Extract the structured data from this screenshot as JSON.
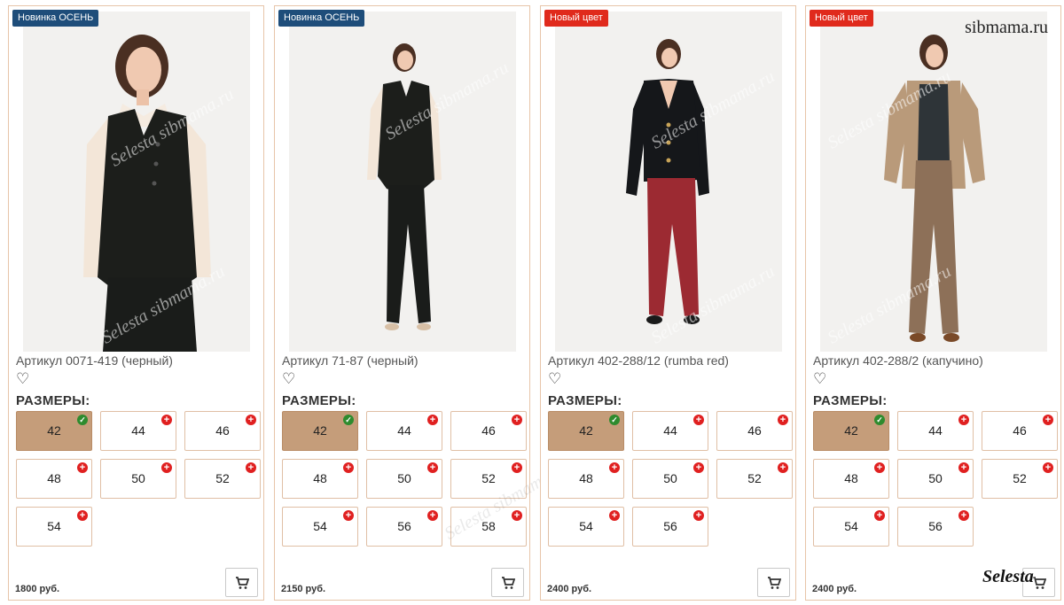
{
  "overlay": {
    "site": "sibmama.ru",
    "brand": "Selesta",
    "watermark": "Selesta sibmama.ru"
  },
  "sizes_title": "РАЗМЕРЫ:",
  "colors": {
    "new_badge": "#1e4d7a",
    "color_badge": "#e02a1c",
    "selected_size": "#c59d7a",
    "add_mark": "#e02020",
    "check_mark": "#2e8b2e"
  },
  "icons": {
    "favorite": "heart-icon",
    "cart": "shopping-cart-icon",
    "available": "check-icon",
    "add": "plus-icon"
  },
  "products": [
    {
      "badge": "Новинка ОСЕНЬ",
      "badge_type": "new",
      "article": "Артикул 0071-419 (черный)",
      "price": "1800 руб.",
      "sizes": [
        "42",
        "44",
        "46",
        "48",
        "50",
        "52",
        "54"
      ],
      "selected_size": "42"
    },
    {
      "badge": "Новинка ОСЕНЬ",
      "badge_type": "new",
      "article": "Артикул 71-87 (черный)",
      "price": "2150 руб.",
      "sizes": [
        "42",
        "44",
        "46",
        "48",
        "50",
        "52",
        "54",
        "56",
        "58"
      ],
      "selected_size": "42"
    },
    {
      "badge": "Новый цвет",
      "badge_type": "color",
      "article": "Артикул 402-288/12 (rumba red)",
      "price": "2400 руб.",
      "sizes": [
        "42",
        "44",
        "46",
        "48",
        "50",
        "52",
        "54",
        "56"
      ],
      "selected_size": "42"
    },
    {
      "badge": "Новый цвет",
      "badge_type": "color",
      "article": "Артикул 402-288/2 (капучино)",
      "price": "2400 руб.",
      "sizes": [
        "42",
        "44",
        "46",
        "48",
        "50",
        "52",
        "54",
        "56"
      ],
      "selected_size": "42"
    }
  ]
}
